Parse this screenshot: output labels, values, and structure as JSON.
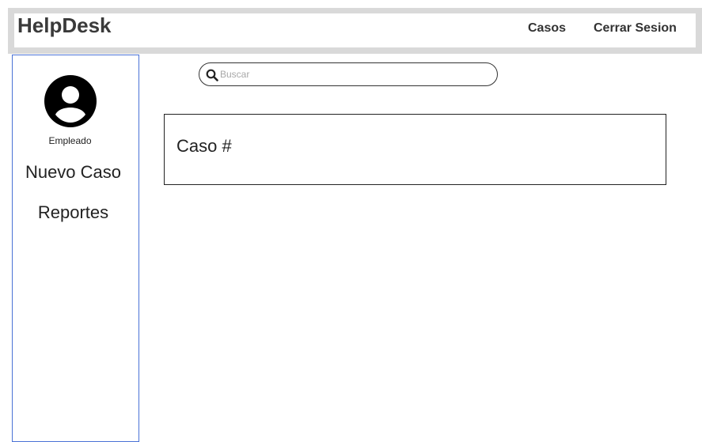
{
  "header": {
    "brand": "HelpDesk",
    "nav": {
      "cases": "Casos",
      "logout": "Cerrar Sesion"
    }
  },
  "sidebar": {
    "role": "Empleado",
    "items": [
      {
        "label": "Nuevo Caso"
      },
      {
        "label": "Reportes"
      }
    ]
  },
  "search": {
    "placeholder": "Buscar",
    "value": ""
  },
  "cases": [
    {
      "title": "Caso #"
    }
  ],
  "colors": {
    "sidebar_border": "#4a72d6",
    "header_frame": "#d9d9d9",
    "brand_text": "#3a3a3a"
  },
  "icons": {
    "avatar": "user-avatar-icon",
    "search": "search-icon"
  }
}
